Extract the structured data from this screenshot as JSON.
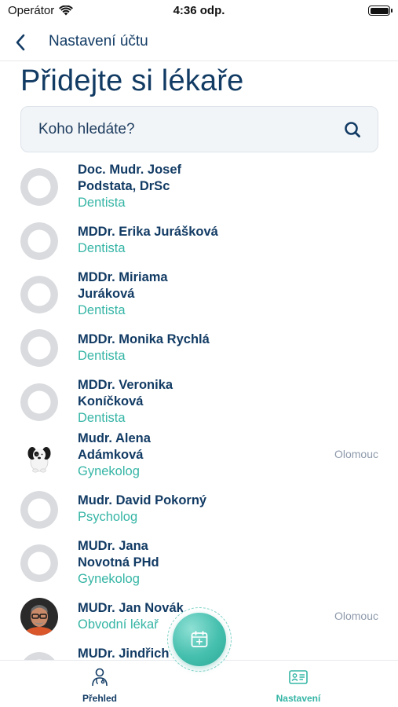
{
  "status_bar": {
    "carrier": "Operátor",
    "time": "4:36 odp."
  },
  "nav": {
    "title": "Nastavení účtu"
  },
  "page": {
    "title": "Přidejte si lékaře"
  },
  "search": {
    "placeholder": "Koho hledáte?",
    "value": ""
  },
  "doctors": [
    {
      "name_line1": "Doc. Mudr. Josef",
      "name_line2": "Podstata, DrSc",
      "specialty": "Dentista",
      "city": "",
      "avatar": "placeholder"
    },
    {
      "name_line1": "MDDr. Erika Jurášková",
      "name_line2": "",
      "specialty": "Dentista",
      "city": "",
      "avatar": "placeholder"
    },
    {
      "name_line1": "MDDr. Miriama",
      "name_line2": "Juráková",
      "specialty": "Dentista",
      "city": "",
      "avatar": "placeholder"
    },
    {
      "name_line1": "MDDr. Monika Rychlá",
      "name_line2": "",
      "specialty": "Dentista",
      "city": "",
      "avatar": "placeholder"
    },
    {
      "name_line1": "MDDr. Veronika",
      "name_line2": "Koníčková",
      "specialty": "Dentista",
      "city": "",
      "avatar": "placeholder"
    },
    {
      "name_line1": "Mudr. Alena",
      "name_line2": "Adámková",
      "specialty": "Gynekolog",
      "city": "Olomouc",
      "avatar": "dog-photo"
    },
    {
      "name_line1": "Mudr. David Pokorný",
      "name_line2": "",
      "specialty": "Psycholog",
      "city": "",
      "avatar": "placeholder"
    },
    {
      "name_line1": "MUDr. Jana",
      "name_line2": "Novotná PHd",
      "specialty": "Gynekolog",
      "city": "",
      "avatar": "placeholder"
    },
    {
      "name_line1": "MUDr. Jan Novák",
      "name_line2": "",
      "specialty": "Obvodní lékař",
      "city": "Olomouc",
      "avatar": "man-photo"
    },
    {
      "name_line1": "MUDr. Jindřich",
      "name_line2": "",
      "specialty": "",
      "city": "",
      "avatar": "placeholder"
    }
  ],
  "tabs": {
    "overview": "Přehled",
    "settings": "Nastavení"
  },
  "colors": {
    "primary": "#123b64",
    "accent": "#35b5a5",
    "muted": "#8e9aab"
  }
}
